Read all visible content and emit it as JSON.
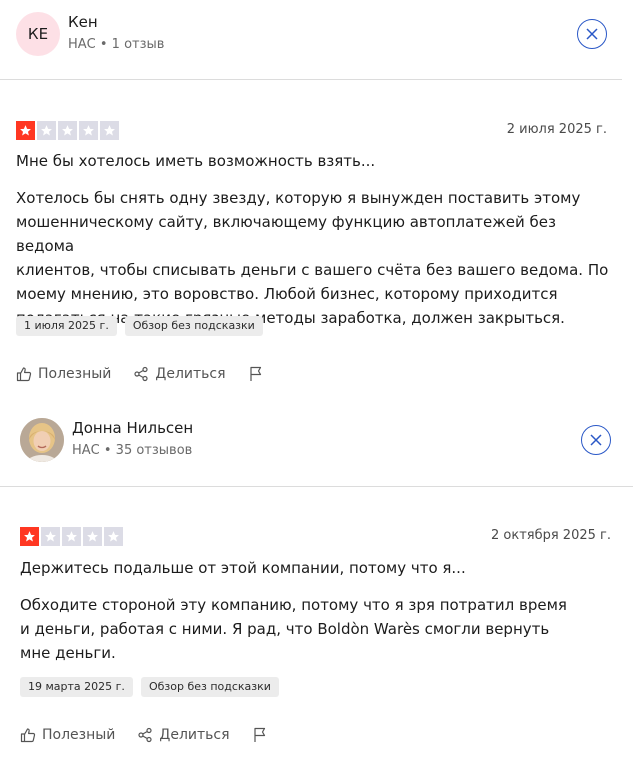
{
  "reviews": [
    {
      "author": {
        "initials": "КЕ",
        "name": "Кен",
        "meta": "НАС • 1 отзыв"
      },
      "rating": 1,
      "date": "2 июля 2025 г.",
      "title": "Мне бы хотелось иметь возможность взять...",
      "body_lines": [
        "Хотелось бы снять одну звезду, которую я вынужден поставить этому",
        "мошенническому сайту, включающему функцию автоплатежей без ведома",
        "клиентов, чтобы списывать деньги с вашего счёта без вашего ведома. По",
        "моему мнению, это воровство. Любой бизнес, которому приходится",
        "полагаться на такие грязные методы заработка, должен закрыться."
      ],
      "tags": [
        "1 июля 2025 г.",
        "Обзор без подсказки"
      ],
      "actions": {
        "useful": "Полезный",
        "share": "Делиться"
      }
    },
    {
      "author": {
        "name": "Донна Нильсен",
        "meta": "НАС • 35 отзывов"
      },
      "rating": 1,
      "date": "2 октября 2025 г.",
      "title": "Держитесь подальше от этой компании, потому что я...",
      "body_lines": [
        "Обходите стороной эту компанию, потому что я зря потратил время",
        "и деньги, работая с ними. Я рад, что Boldòn Warès смогли вернуть",
        "мне деньги."
      ],
      "tags": [
        "19 марта 2025 г.",
        "Обзор без подсказки"
      ],
      "actions": {
        "useful": "Полезный",
        "share": "Делиться"
      }
    }
  ],
  "colors": {
    "star_on": "#ff3722",
    "star_off": "#dcdce6",
    "close_accent": "#2a58c7"
  },
  "icons": {
    "like": "thumbs-up-icon",
    "share": "share-icon",
    "flag": "flag-icon",
    "close": "close-icon",
    "star": "star-icon"
  }
}
